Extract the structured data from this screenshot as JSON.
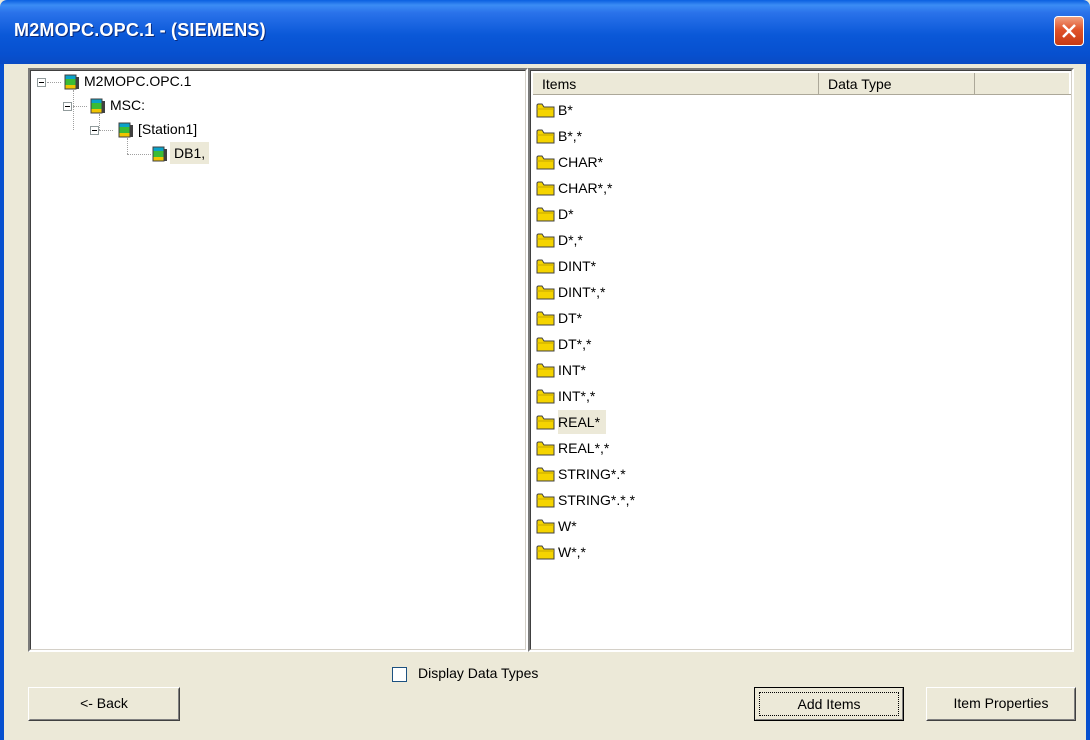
{
  "window": {
    "title": "M2MOPC.OPC.1 - (SIEMENS)"
  },
  "tree": {
    "root": "M2MOPC.OPC.1",
    "level1": "MSC:",
    "level2": "[Station1]",
    "level3": "DB1,"
  },
  "list": {
    "columns": [
      "Items",
      "Data Type"
    ],
    "items": [
      "B*",
      "B*,*",
      "CHAR*",
      "CHAR*,*",
      "D*",
      "D*,*",
      "DINT*",
      "DINT*,*",
      "DT*",
      "DT*,*",
      "INT*",
      "INT*,*",
      "REAL*",
      "REAL*,*",
      "STRING*.*",
      "STRING*.*,*",
      "W*",
      "W*,*"
    ],
    "selected_item": "REAL*"
  },
  "options": {
    "display_data_types_label": "Display Data Types",
    "display_data_types_checked": false
  },
  "buttons": {
    "back": "<- Back",
    "add_items": "Add Items",
    "item_properties": "Item Properties"
  },
  "colors": {
    "title_bar": "#0750cf",
    "face": "#ece9d8",
    "folder": "#f5d400",
    "close": "#e0532a"
  }
}
